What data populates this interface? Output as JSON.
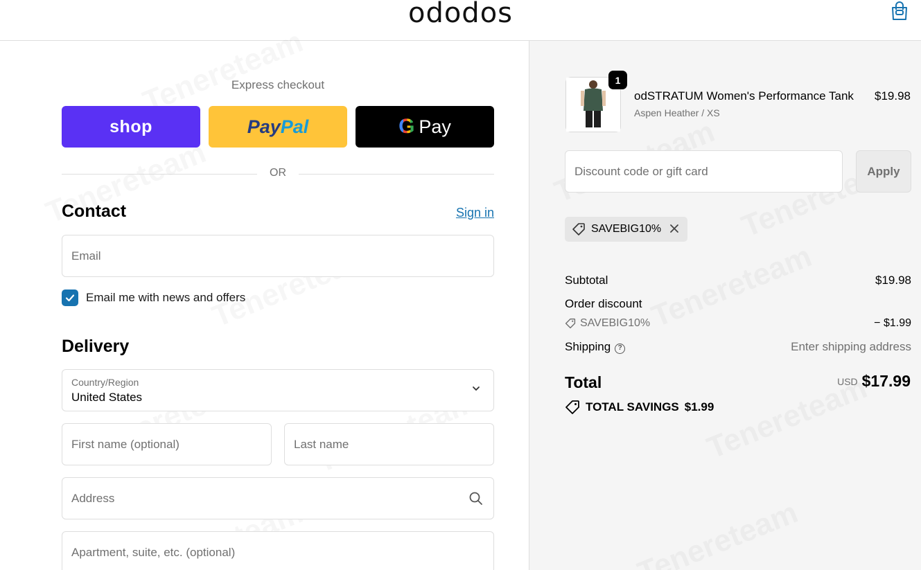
{
  "header": {
    "logo": "ododos",
    "cart_icon": "shopping-bag-icon"
  },
  "express": {
    "title": "Express checkout",
    "shop_label": "shop",
    "paypal_label_1": "Pay",
    "paypal_label_2": "Pal",
    "gpay_g": "G",
    "gpay_label": "Pay",
    "or_text": "OR"
  },
  "contact": {
    "title": "Contact",
    "signin": "Sign in",
    "email_placeholder": "Email",
    "newsletter_label": "Email me with news and offers",
    "newsletter_checked": true
  },
  "delivery": {
    "title": "Delivery",
    "country_label": "Country/Region",
    "country_value": "United States",
    "first_name_placeholder": "First name (optional)",
    "last_name_placeholder": "Last name",
    "address_placeholder": "Address",
    "apartment_placeholder": "Apartment, suite, etc. (optional)"
  },
  "order": {
    "product_name": "odSTRATUM Women's Performance Tank",
    "product_variant": "Aspen Heather / XS",
    "product_price": "$19.98",
    "quantity": "1",
    "discount_placeholder": "Discount code or gift card",
    "apply_label": "Apply",
    "applied_code": "SAVEBIG10%",
    "subtotal_label": "Subtotal",
    "subtotal_value": "$19.98",
    "order_discount_label": "Order discount",
    "discount_code": "SAVEBIG10%",
    "discount_value": "− $1.99",
    "shipping_label": "Shipping",
    "shipping_value": "Enter shipping address",
    "total_label": "Total",
    "total_currency": "USD",
    "total_value": "$17.99",
    "savings_label": "TOTAL SAVINGS",
    "savings_value": "$1.99"
  },
  "colors": {
    "shop_pay": "#5a31f4",
    "paypal": "#ffc439",
    "gpay": "#000000",
    "link": "#1773b0",
    "summary_bg": "#f5f5f5"
  }
}
